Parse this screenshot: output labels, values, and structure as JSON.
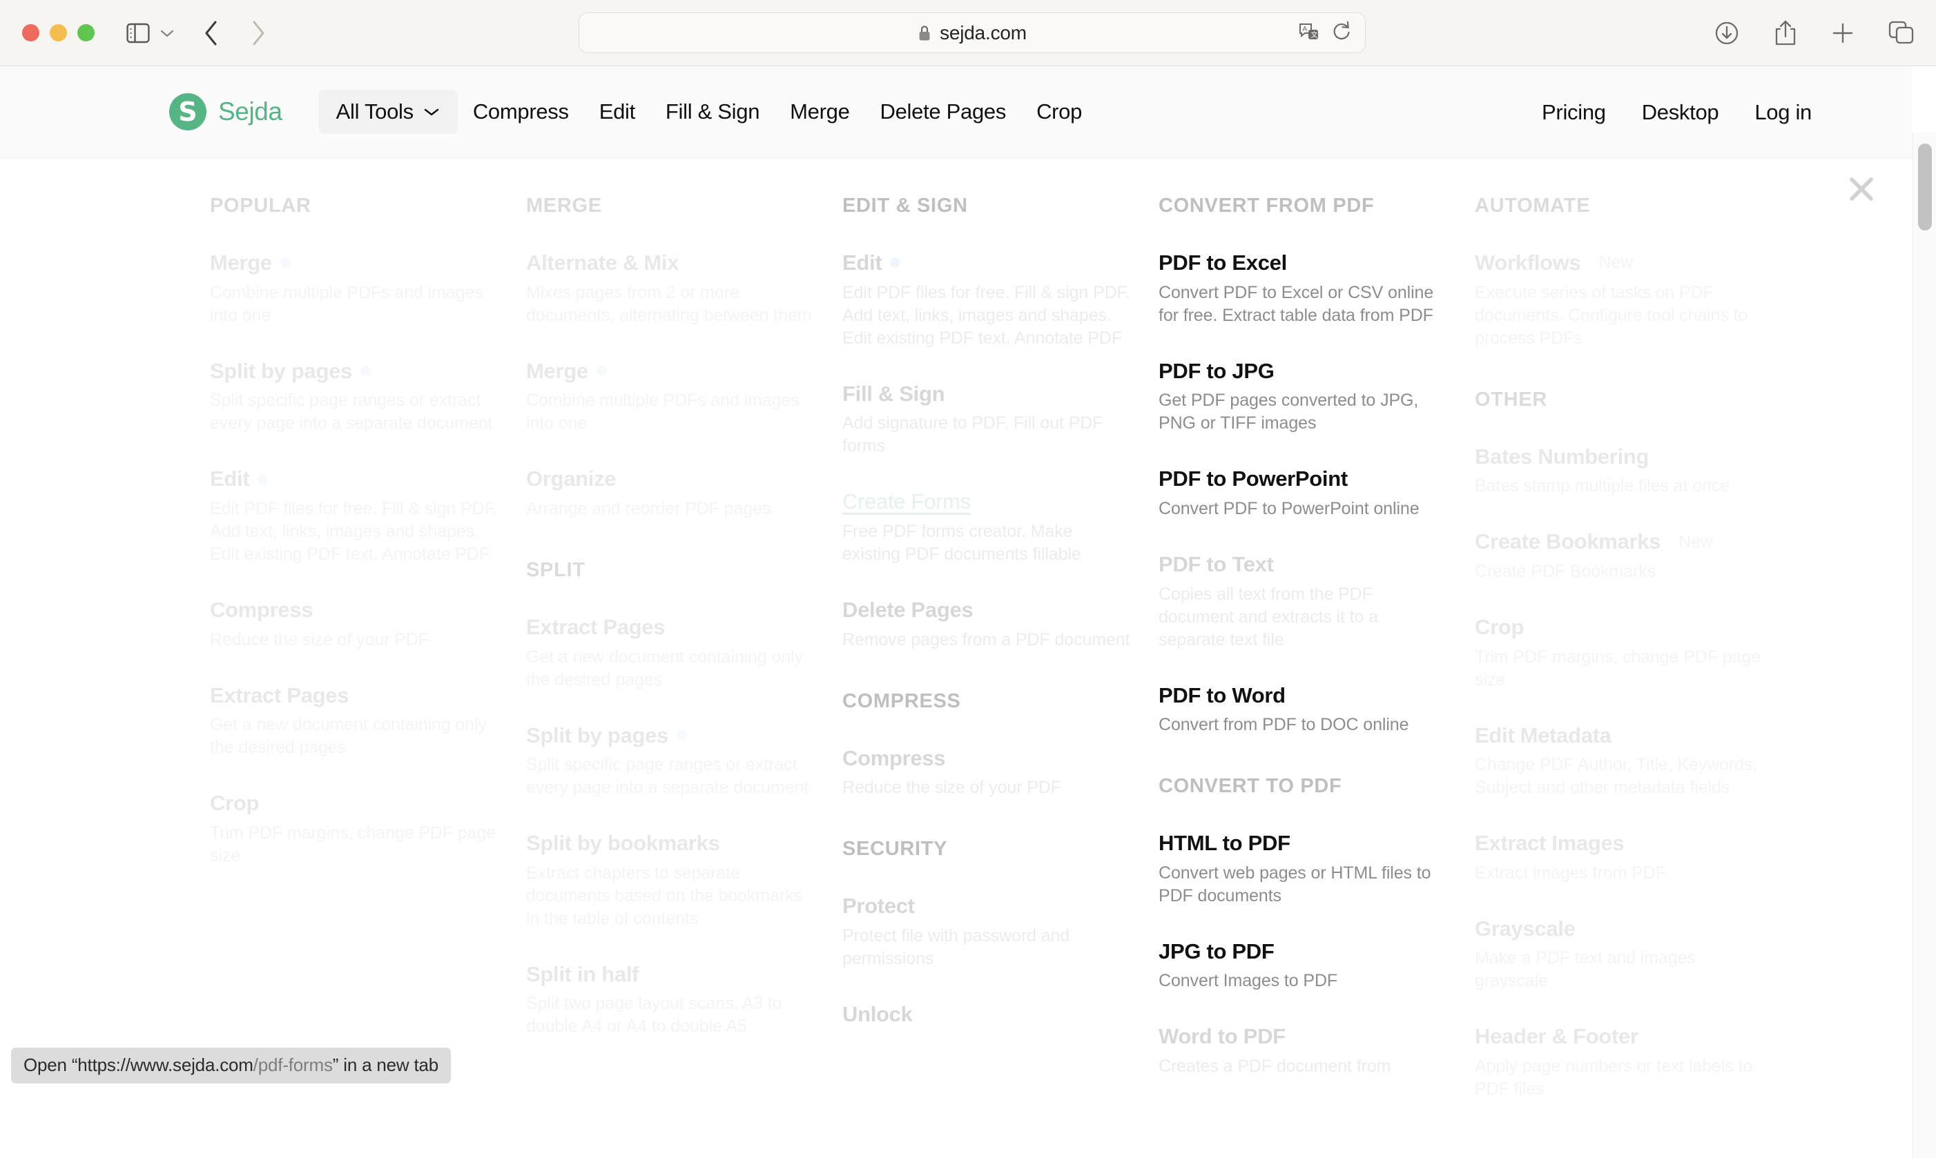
{
  "browser": {
    "traffic_lights": [
      "close",
      "minimize",
      "zoom"
    ],
    "sidebar_toggle_icon": "sidebar-icon",
    "sidebar_chevron_icon": "chevron-down-icon",
    "back_icon": "chevron-left-icon",
    "forward_icon": "chevron-right-icon",
    "address": {
      "lock_icon": "lock-icon",
      "url": "sejda.com",
      "translate_icon": "translate-icon",
      "reload_icon": "reload-icon"
    },
    "toolbar_right": [
      "download-icon",
      "share-icon",
      "new-tab-icon",
      "tab-overview-icon"
    ],
    "status_bar": {
      "prefix": "Open “https://www.sejda.com",
      "path": "/pdf-forms",
      "suffix": "” in a new tab"
    }
  },
  "site": {
    "brand": {
      "mark": "S",
      "name": "Sejda",
      "color": "#56b585"
    },
    "primary_nav": [
      {
        "label": "All Tools",
        "chevron": "chevron-down-icon",
        "active": true
      },
      {
        "label": "Compress"
      },
      {
        "label": "Edit"
      },
      {
        "label": "Fill & Sign"
      },
      {
        "label": "Merge"
      },
      {
        "label": "Delete Pages"
      },
      {
        "label": "Crop"
      }
    ],
    "secondary_nav": [
      {
        "label": "Pricing"
      },
      {
        "label": "Desktop"
      },
      {
        "label": "Log in"
      }
    ]
  },
  "mega_menu": {
    "close_icon": "close-icon",
    "badge_new": "New",
    "columns": [
      {
        "sections": [
          {
            "heading": "POPULAR",
            "fade": "fade-2",
            "items": [
              {
                "title": "Merge",
                "desc": "Combine multiple PDFs and images into one",
                "dot": true,
                "fade": "fade-4"
              },
              {
                "title": "Split by pages",
                "desc": "Split specific page ranges or extract every page into a separate document",
                "dot": true,
                "fade": "fade-4"
              },
              {
                "title": "Edit",
                "desc": "Edit PDF files for free. Fill & sign PDF. Add text, links, images and shapes. Edit existing PDF text. Annotate PDF",
                "dot": true,
                "fade": "fade-4"
              },
              {
                "title": "Compress",
                "desc": "Reduce the size of your PDF",
                "fade": "fade-4"
              },
              {
                "title": "Extract Pages",
                "desc": "Get a new document containing only the desired pages",
                "fade": "fade-4"
              },
              {
                "title": "Crop",
                "desc": "Trim PDF margins, change PDF page size",
                "fade": "fade-4"
              }
            ]
          }
        ]
      },
      {
        "sections": [
          {
            "heading": "MERGE",
            "fade": "fade-2",
            "items": [
              {
                "title": "Alternate & Mix",
                "desc": "Mixes pages from 2 or more documents, alternating between them",
                "fade": "fade-4"
              },
              {
                "title": "Merge",
                "desc": "Combine multiple PDFs and images into one",
                "dot": true,
                "fade": "fade-4"
              },
              {
                "title": "Organize",
                "desc": "Arrange and reorder PDF pages",
                "fade": "fade-4"
              }
            ]
          },
          {
            "heading": "SPLIT",
            "fade": "fade-2",
            "items": [
              {
                "title": "Extract Pages",
                "desc": "Get a new document containing only the desired pages",
                "fade": "fade-4"
              },
              {
                "title": "Split by pages",
                "desc": "Split specific page ranges or extract every page into a separate document",
                "dot": true,
                "fade": "fade-4"
              },
              {
                "title": "Split by bookmarks",
                "desc": "Extract chapters to separate documents based on the bookmarks in the table of contents",
                "fade": "fade-4"
              },
              {
                "title": "Split in half",
                "desc": "Split two page layout scans, A3 to double A4 or A4 to double A5",
                "fade": "fade-4"
              }
            ]
          }
        ]
      },
      {
        "sections": [
          {
            "heading": "EDIT & SIGN",
            "fade": "fade-1",
            "items": [
              {
                "title": "Edit",
                "desc": "Edit PDF files for free. Fill & sign PDF. Add text, links, images and shapes. Edit existing PDF text. Annotate PDF",
                "dot": true,
                "fade": "fade-3"
              },
              {
                "title": "Fill & Sign",
                "desc": "Add signature to PDF. Fill out PDF forms",
                "fade": "fade-3"
              },
              {
                "title": "Create Forms",
                "desc": "Free PDF forms creator. Make existing PDF documents fillable",
                "hovered": true,
                "fade": "fade-3"
              },
              {
                "title": "Delete Pages",
                "desc": "Remove pages from a PDF document",
                "fade": "fade-3"
              }
            ]
          },
          {
            "heading": "COMPRESS",
            "fade": "fade-1",
            "items": [
              {
                "title": "Compress",
                "desc": "Reduce the size of your PDF",
                "fade": "fade-3"
              }
            ]
          },
          {
            "heading": "SECURITY",
            "fade": "fade-1",
            "items": [
              {
                "title": "Protect",
                "desc": "Protect file with password and permissions",
                "fade": "fade-3"
              },
              {
                "title": "Unlock",
                "desc": "",
                "fade": "fade-3"
              }
            ]
          }
        ]
      },
      {
        "sections": [
          {
            "heading": "CONVERT FROM PDF",
            "fade": "fade-1",
            "items": [
              {
                "title": "PDF to Excel",
                "desc": "Convert PDF to Excel or CSV online for free. Extract table data from PDF",
                "fade": "fade-0"
              },
              {
                "title": "PDF to JPG",
                "desc": "Get PDF pages converted to JPG, PNG or TIFF images",
                "fade": "fade-0"
              },
              {
                "title": "PDF to PowerPoint",
                "desc": "Convert PDF to PowerPoint online",
                "fade": "fade-0"
              },
              {
                "title": "PDF to Text",
                "desc": "Copies all text from the PDF document and extracts it to a separate text file",
                "fade": "fade-3"
              },
              {
                "title": "PDF to Word",
                "desc": "Convert from PDF to DOC online",
                "fade": "fade-0"
              }
            ]
          },
          {
            "heading": "CONVERT TO PDF",
            "fade": "fade-1",
            "items": [
              {
                "title": "HTML to PDF",
                "desc": "Convert web pages or HTML files to PDF documents",
                "fade": "fade-0"
              },
              {
                "title": "JPG to PDF",
                "desc": "Convert Images to PDF",
                "fade": "fade-0"
              },
              {
                "title": "Word to PDF",
                "desc": "Creates a PDF document from",
                "fade": "fade-3"
              }
            ]
          }
        ]
      },
      {
        "sections": [
          {
            "heading": "AUTOMATE",
            "fade": "fade-2",
            "items": [
              {
                "title": "Workflows",
                "badge": "New",
                "desc": "Execute series of tasks on PDF documents. Configure tool chains to process PDFs",
                "fade": "fade-4"
              }
            ]
          },
          {
            "heading": "OTHER",
            "fade": "fade-2",
            "items": [
              {
                "title": "Bates Numbering",
                "desc": "Bates stamp multiple files at once",
                "fade": "fade-4"
              },
              {
                "title": "Create Bookmarks",
                "badge": "New",
                "desc": "Create PDF Bookmarks",
                "fade": "fade-4"
              },
              {
                "title": "Crop",
                "desc": "Trim PDF margins, change PDF page size",
                "fade": "fade-4"
              },
              {
                "title": "Edit Metadata",
                "desc": "Change PDF Author, Title, Keywords, Subject and other metadata fields",
                "fade": "fade-4"
              },
              {
                "title": "Extract Images",
                "desc": "Extract images from PDF",
                "fade": "fade-4"
              },
              {
                "title": "Grayscale",
                "desc": "Make a PDF text and images grayscale",
                "fade": "fade-4"
              },
              {
                "title": "Header & Footer",
                "desc": "Apply page numbers or text labels to PDF files",
                "fade": "fade-4"
              }
            ]
          }
        ]
      }
    ]
  }
}
